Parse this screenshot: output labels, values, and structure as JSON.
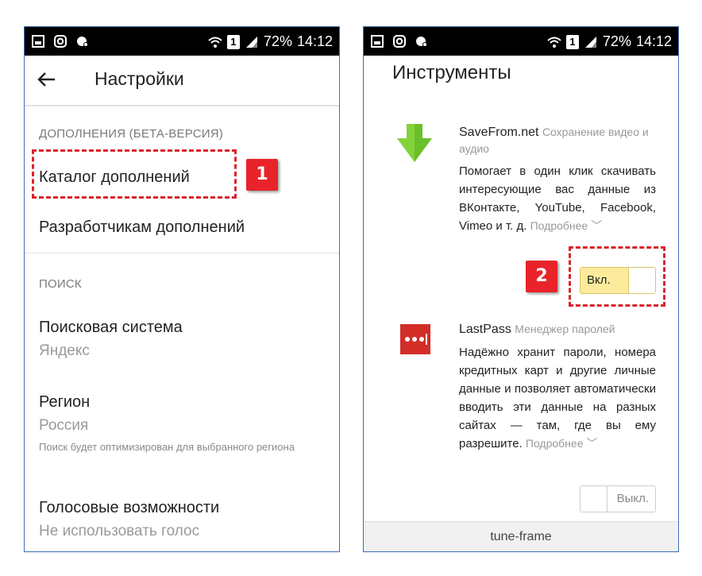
{
  "status_bar": {
    "battery": "72%",
    "time": "14:12",
    "sim": "1"
  },
  "settings": {
    "title": "Настройки",
    "addons_section": "ДОПОЛНЕНИЯ (БЕТА-ВЕРСИЯ)",
    "addons_catalog": "Каталог дополнений",
    "addons_developers": "Разработчикам дополнений",
    "search_section": "ПОИСК",
    "search_engine_label": "Поисковая система",
    "search_engine_value": "Яндекс",
    "region_label": "Регион",
    "region_value": "Россия",
    "region_note": "Поиск будет оптимизирован для выбранного региона",
    "voice_label": "Голосовые возможности",
    "voice_value": "Не использовать голос"
  },
  "tools": {
    "title": "Инструменты",
    "extensions": [
      {
        "name": "SaveFrom.net",
        "category": "Сохранение видео и аудио",
        "description": "Помогает в один клик скачивать интересующие вас данные из ВКонтакте, YouTube, Facebook, Vimeo и т. д.",
        "more": "Подробнее",
        "toggle_label": "Вкл.",
        "enabled": true
      },
      {
        "name": "LastPass",
        "category": "Менеджер паролей",
        "description": "Надёжно хранит пароли, номера кредитных карт и другие личные данные и позволяет автоматически вводить эти данные на разных сайтах — там, где вы ему разрешите.",
        "more": "Подробнее",
        "toggle_label": "Выкл.",
        "enabled": false
      }
    ],
    "footer": "tune-frame"
  },
  "callouts": {
    "step1": "1",
    "step2": "2"
  },
  "colors": {
    "callout_red": "#e8232a",
    "toggle_on": "#fdeb9c",
    "savefrom_green": "#6abf2a",
    "lastpass_red": "#d32d27"
  }
}
